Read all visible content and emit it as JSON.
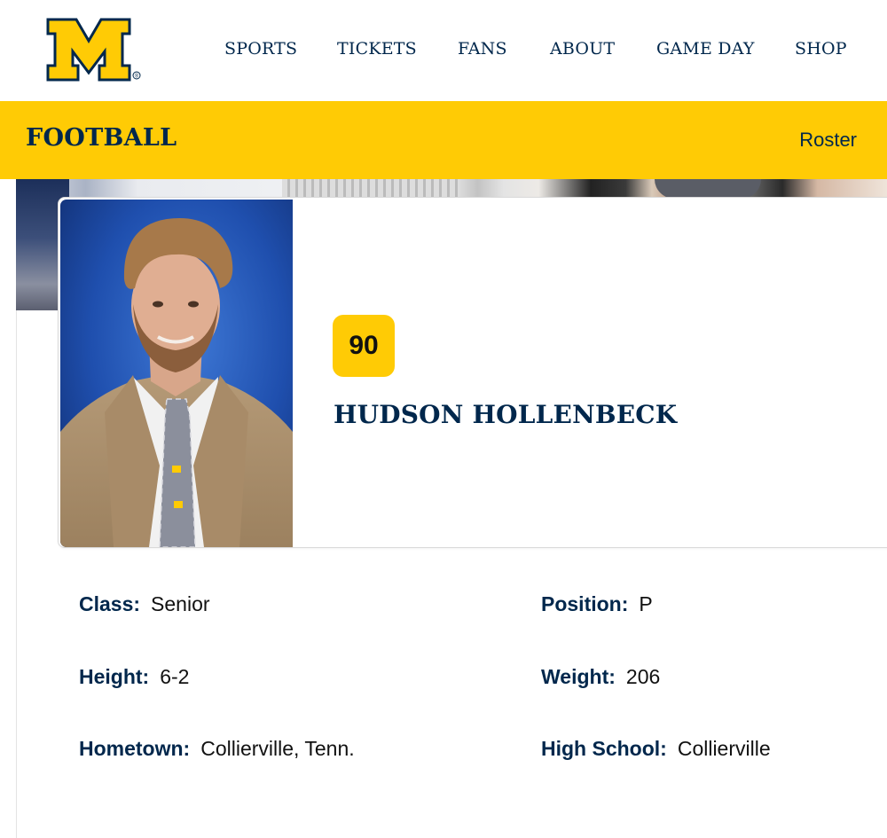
{
  "brand": {
    "logo_letter": "M",
    "registered_mark": "®",
    "maize": "#ffcb05",
    "blue": "#00274c"
  },
  "nav": {
    "items": [
      {
        "label": "SPORTS"
      },
      {
        "label": "TICKETS"
      },
      {
        "label": "FANS"
      },
      {
        "label": "ABOUT"
      },
      {
        "label": "GAME DAY"
      },
      {
        "label": "SHOP"
      }
    ]
  },
  "sub_header": {
    "title": "FOOTBALL",
    "link": "Roster"
  },
  "player": {
    "number": "90",
    "name": "HUDSON HOLLENBECK",
    "photo_icon": "player-headshot"
  },
  "bio": {
    "class": {
      "label": "Class:",
      "value": "Senior"
    },
    "position": {
      "label": "Position:",
      "value": "P"
    },
    "height": {
      "label": "Height:",
      "value": "6-2"
    },
    "weight": {
      "label": "Weight:",
      "value": "206"
    },
    "hometown": {
      "label": "Hometown:",
      "value": "Collierville, Tenn."
    },
    "high_school": {
      "label": "High School:",
      "value": "Collierville"
    }
  }
}
